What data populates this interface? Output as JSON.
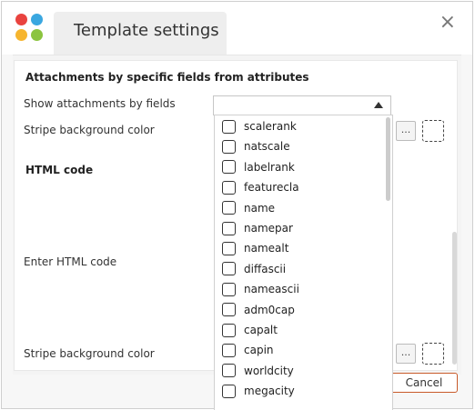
{
  "dialog": {
    "tab_title": "Template settings",
    "close_glyph": "×"
  },
  "sections": {
    "attachments_title": "Attachments by specific fields from attributes",
    "show_attachments_label": "Show attachments by fields",
    "stripe_bg_label_1": "Stripe background color",
    "html_code_title": "HTML code",
    "enter_html_label": "Enter HTML code",
    "stripe_bg_label_2": "Stripe background color",
    "dots_label": "..."
  },
  "buttons": {
    "cancel": "Cancel"
  },
  "dropdown": {
    "items": [
      "scalerank",
      "natscale",
      "labelrank",
      "featurecla",
      "name",
      "namepar",
      "namealt",
      "diffascii",
      "nameascii",
      "adm0cap",
      "capalt",
      "capin",
      "worldcity",
      "megacity"
    ]
  },
  "colors": {
    "logo": [
      "#e9433f",
      "#3aa7e0",
      "#f6b52f",
      "#8bc43f"
    ],
    "cancel_border": "#c85a2a"
  }
}
